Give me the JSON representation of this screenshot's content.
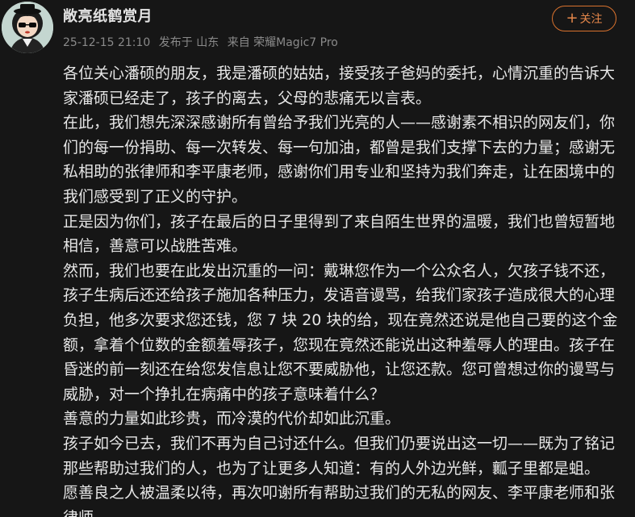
{
  "header": {
    "username": "敞亮纸鹤赏月",
    "timestamp": "25-12-15 21:10",
    "published_from": "发布于 山东",
    "device": "来自 荣耀Magic7 Pro",
    "follow_label": "关注",
    "follow_icon": "plus-icon"
  },
  "post": {
    "lines": [
      "各位关心潘硕的朋友，我是潘硕的姑姑，接受孩子爸妈的委托，心情沉重的告诉大",
      "家潘硕已经走了，孩子的离去，父母的悲痛无以言表。",
      "在此，我们想先深深感谢所有曾给予我们光亮的人——感谢素不相识的网友们，你",
      "们的每一份捐助、每一次转发、每一句加油，都曾是我们支撑下去的力量；感谢无",
      "私相助的张律师和李平康老师，感谢你们用专业和坚持为我们奔走，让在困境中的",
      "我们感受到了正义的守护。",
      "正是因为你们，孩子在最后的日子里得到了来自陌生世界的温暖，我们也曾短暂地",
      "相信，善意可以战胜苦难。",
      "然而，我们也要在此发出沉重的一问：戴琳您作为一个公众名人，欠孩子钱不还，",
      "孩子生病后还还给孩子施加各种压力，发语音谩骂，给我们家孩子造成很大的心理",
      "负担，他多次要求您还钱，您 7 块 20 块的给，现在竟然还说是他自己要的这个金",
      "额，拿着个位数的金额羞辱孩子，您现在竟然还能说出这种羞辱人的理由。孩子在",
      "昏迷的前一刻还在给您发信息让您不要威胁他，让您还款。您可曾想过你的谩骂与",
      "威胁，对一个挣扎在病痛中的孩子意味着什么？",
      "善意的力量如此珍贵，而冷漠的代价却如此沉重。",
      "孩子如今已去，我们不再为自己讨还什么。但我们仍要说出这一切——既为了铭记",
      "那些帮助过我们的人，也为了让更多人知道：有的人外边光鲜，瓤子里都是蛆。",
      "愿善良之人被温柔以待，再次叩谢所有帮助过我们的无私的网友、李平康老师和张",
      "律师。"
    ]
  },
  "colors": {
    "background": "#161616",
    "text": "#e6e6e6",
    "meta": "#8a8a8a",
    "accent": "#e5874a"
  }
}
